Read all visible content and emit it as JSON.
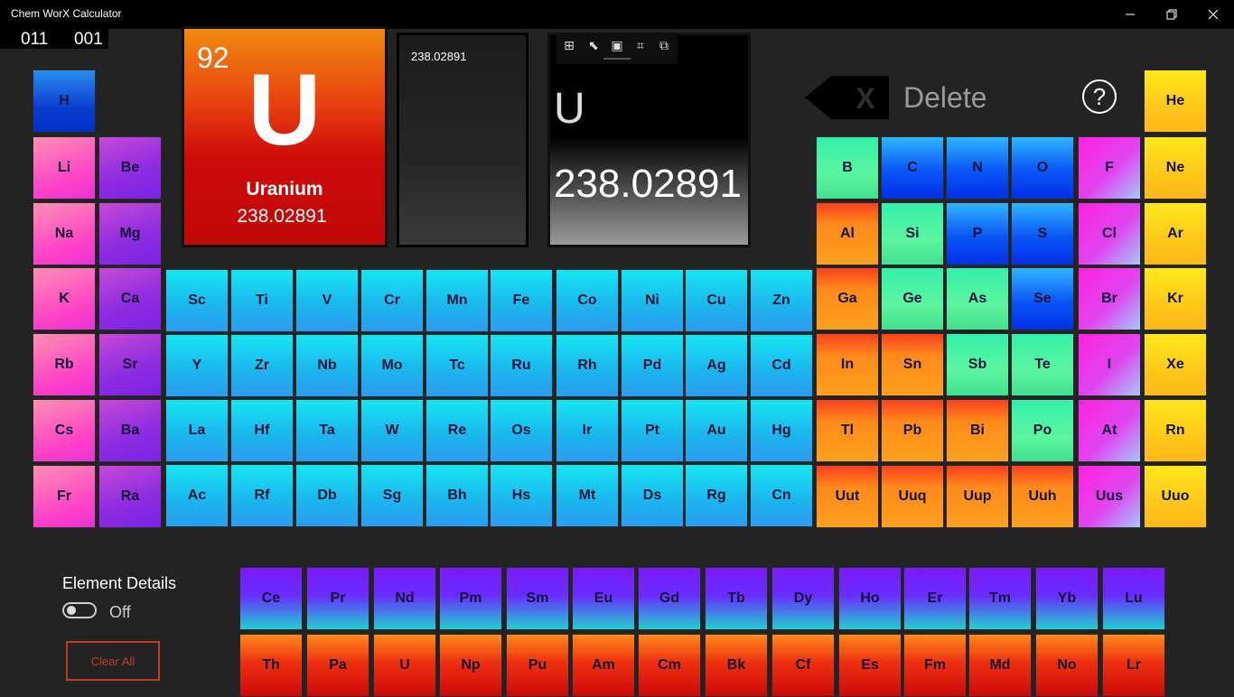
{
  "window": {
    "title": "Chem WorX Calculator"
  },
  "counters": {
    "left": "011",
    "right": "001"
  },
  "selected": {
    "number": "92",
    "symbol": "U",
    "name": "Uranium",
    "mass": "238.02891"
  },
  "history": {
    "value": "238.02891"
  },
  "display": {
    "symbol": "U",
    "value": "238.02891"
  },
  "delete": {
    "icon_glyph": "X",
    "label": "Delete"
  },
  "help": {
    "label": "?"
  },
  "details": {
    "title": "Element Details",
    "toggle_state": "Off"
  },
  "clear_all": {
    "label": "Clear All"
  },
  "elements": {
    "H": "H",
    "He": "He",
    "Li": "Li",
    "Be": "Be",
    "Na": "Na",
    "Mg": "Mg",
    "K": "K",
    "Ca": "Ca",
    "Rb": "Rb",
    "Sr": "Sr",
    "Cs": "Cs",
    "Ba": "Ba",
    "Fr": "Fr",
    "Ra": "Ra",
    "Sc": "Sc",
    "Ti": "Ti",
    "V": "V",
    "Cr": "Cr",
    "Mn": "Mn",
    "Fe": "Fe",
    "Co": "Co",
    "Ni": "Ni",
    "Cu": "Cu",
    "Zn": "Zn",
    "Y": "Y",
    "Zr": "Zr",
    "Nb": "Nb",
    "Mo": "Mo",
    "Tc": "Tc",
    "Ru": "Ru",
    "Rh": "Rh",
    "Pd": "Pd",
    "Ag": "Ag",
    "Cd": "Cd",
    "La": "La",
    "Hf": "Hf",
    "Ta": "Ta",
    "W": "W",
    "Re": "Re",
    "Os": "Os",
    "Ir": "Ir",
    "Pt": "Pt",
    "Au": "Au",
    "Hg": "Hg",
    "Ac": "Ac",
    "Rf": "Rf",
    "Db": "Db",
    "Sg": "Sg",
    "Bh": "Bh",
    "Hs": "Hs",
    "Mt": "Mt",
    "Ds": "Ds",
    "Rg": "Rg",
    "Cn": "Cn",
    "B": "B",
    "C": "C",
    "N": "N",
    "O": "O",
    "F": "F",
    "Ne": "Ne",
    "Al": "Al",
    "Si": "Si",
    "P": "P",
    "S": "S",
    "Cl": "Cl",
    "Ar": "Ar",
    "Ga": "Ga",
    "Ge": "Ge",
    "As": "As",
    "Se": "Se",
    "Br": "Br",
    "Kr": "Kr",
    "In": "In",
    "Sn": "Sn",
    "Sb": "Sb",
    "Te": "Te",
    "I": "I",
    "Xe": "Xe",
    "Tl": "Tl",
    "Pb": "Pb",
    "Bi": "Bi",
    "Po": "Po",
    "At": "At",
    "Rn": "Rn",
    "Uut": "Uut",
    "Uuq": "Uuq",
    "Uup": "Uup",
    "Uuh": "Uuh",
    "Uus": "Uus",
    "Uuo": "Uuo",
    "Ce": "Ce",
    "Pr": "Pr",
    "Nd": "Nd",
    "Pm": "Pm",
    "Sm": "Sm",
    "Eu": "Eu",
    "Gd": "Gd",
    "Tb": "Tb",
    "Dy": "Dy",
    "Ho": "Ho",
    "Er": "Er",
    "Tm": "Tm",
    "Yb": "Yb",
    "Lu": "Lu",
    "Th": "Th",
    "Pa": "Pa",
    "U": "U",
    "Np": "Np",
    "Pu": "Pu",
    "Am": "Am",
    "Cm": "Cm",
    "Bk": "Bk",
    "Cf": "Cf",
    "Es": "Es",
    "Fm": "Fm",
    "Md": "Md",
    "No": "No",
    "Lr": "Lr"
  },
  "colors": {
    "background": "#232323",
    "titlebar": "#000000",
    "clear_all_border": "#c0392b",
    "uranium_card": "#c00808"
  }
}
